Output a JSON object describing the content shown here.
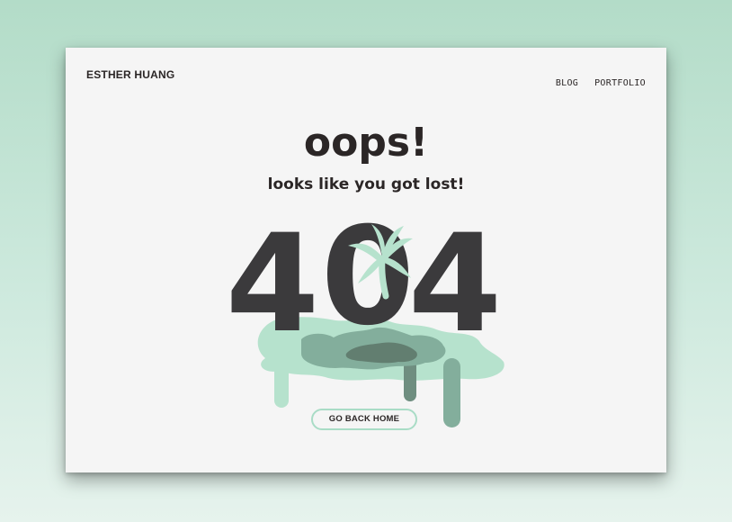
{
  "page": {
    "background_top": "#b3dcc8",
    "background_bottom": "#e6f3ed",
    "card_color": "#f5f5f5"
  },
  "header": {
    "brand": "ESTHER HUANG",
    "nav": [
      {
        "label": "BLOG"
      },
      {
        "label": "PORTFOLIO"
      }
    ]
  },
  "main": {
    "headline": "oops!",
    "subline": "looks like you got lost!",
    "error_code": [
      "4",
      "0",
      "4"
    ],
    "button_label": "GO BACK HOME"
  },
  "illustration": {
    "icons": [
      "palm-tree-icon",
      "puddle-icon"
    ],
    "digit_color": "#3b3a3c",
    "puddle_light": "#b6e2cd",
    "puddle_mid": "#83ae9c",
    "puddle_dark": "#627e70"
  }
}
